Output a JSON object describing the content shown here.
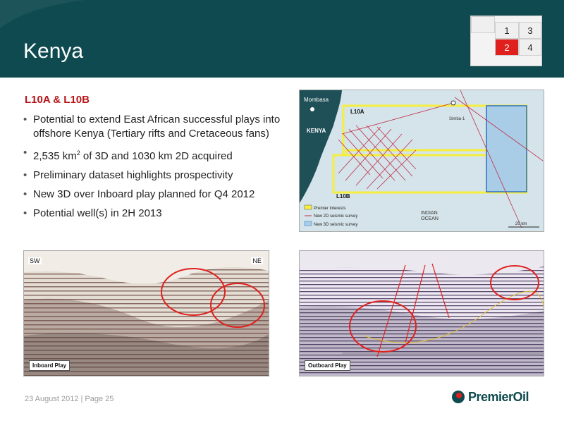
{
  "header": {
    "title": "Kenya",
    "nav": [
      "1",
      "3",
      "2",
      "4"
    ],
    "active_nav": "2"
  },
  "content": {
    "subhead": "L10A & L10B",
    "bullets": [
      "Potential to extend East African successful plays into offshore Kenya (Tertiary rifts and Cretaceous fans)",
      "2,535 km",
      "2",
      " of 3D and 1030 km 2D acquired",
      "Preliminary dataset highlights prospectivity",
      "New 3D over Inboard play planned for Q4 2012",
      "Potential well(s) in 2H 2013"
    ]
  },
  "map": {
    "labels": {
      "mombasa": "Mombasa",
      "kenya": "KENYA",
      "l10a": "L10A",
      "l10b": "L10B",
      "simba": "Simba-1",
      "indian": "INDIAN",
      "ocean": "OCEAN",
      "scale": "20 km"
    },
    "legend": [
      "Premier interests",
      "New 2D seismic survey",
      "New 3D seismic survey"
    ],
    "colors": {
      "sea": "#d5e4ea",
      "land": "#1f4f57",
      "block": "#f5ee3c",
      "survey2d": "#c0304a",
      "survey3d": "#a9cde6"
    }
  },
  "seismic": {
    "left": {
      "sw": "SW",
      "ne": "NE",
      "label": "Inboard Play"
    },
    "right": {
      "label": "Outboard Play"
    }
  },
  "footer": {
    "date_page": "23 August 2012 | Page 25",
    "logo": "PremierOil"
  }
}
